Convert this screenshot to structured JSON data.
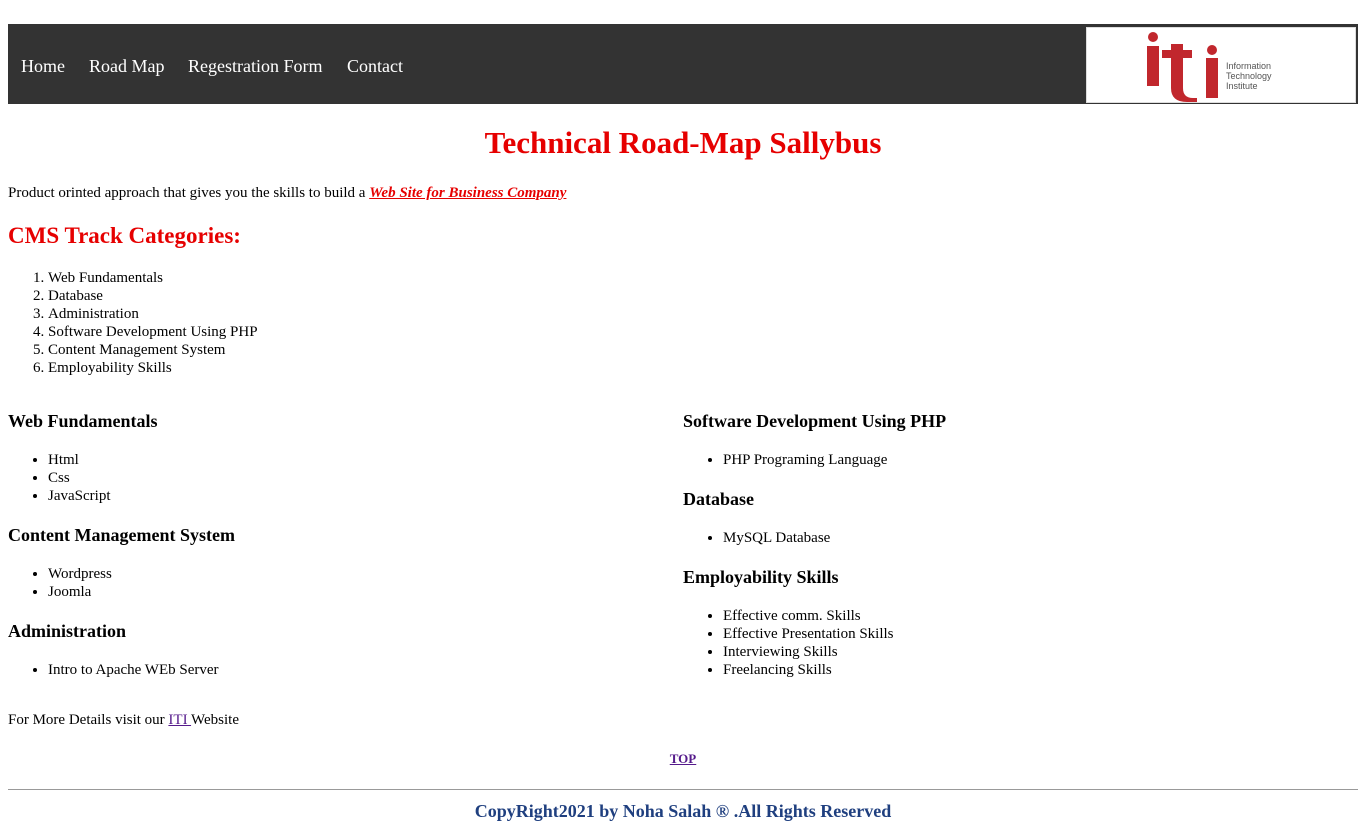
{
  "nav": {
    "items": [
      "Home",
      "Road Map",
      "Regestration Form",
      "Contact"
    ],
    "logo": {
      "line1": "Information",
      "line2": "Technology",
      "line3": "Institute"
    }
  },
  "title": "Technical Road-Map Sallybus",
  "intro": {
    "text": "Product orinted approach that gives you the skills to build a ",
    "link": "Web Site for Business Company"
  },
  "cms": {
    "title": "CMS Track Categories:",
    "items": [
      "Web Fundamentals",
      "Database",
      "Administration",
      "Software Development Using PHP",
      "Content Management System",
      "Employability Skills"
    ]
  },
  "left": {
    "web": {
      "title": "Web Fundamentals",
      "items": [
        "Html",
        "Css",
        "JavaScript"
      ]
    },
    "cms": {
      "title": "Content Management System",
      "items": [
        "Wordpress",
        "Joomla"
      ]
    },
    "admin": {
      "title": "Administration",
      "items": [
        "Intro to Apache WEb Server"
      ]
    }
  },
  "right": {
    "php": {
      "title": "Software Development Using PHP",
      "items": [
        "PHP Programing Language"
      ]
    },
    "db": {
      "title": "Database",
      "items": [
        "MySQL Database"
      ]
    },
    "emp": {
      "title": "Employability Skills",
      "items": [
        "Effective comm. Skills",
        "Effective Presentation Skills",
        "Interviewing Skills",
        "Freelancing Skills"
      ]
    }
  },
  "more": {
    "prefix": "For More Details visit our ",
    "link": "ITI ",
    "suffix": "Website"
  },
  "top": "TOP",
  "footer": "CopyRight2021 by Noha Salah ® .All Rights Reserved",
  "colors": {
    "nav_bg": "#333333",
    "accent_red": "#e60000",
    "footer_blue": "#1f3f7f",
    "logo_red": "#c1272d"
  }
}
